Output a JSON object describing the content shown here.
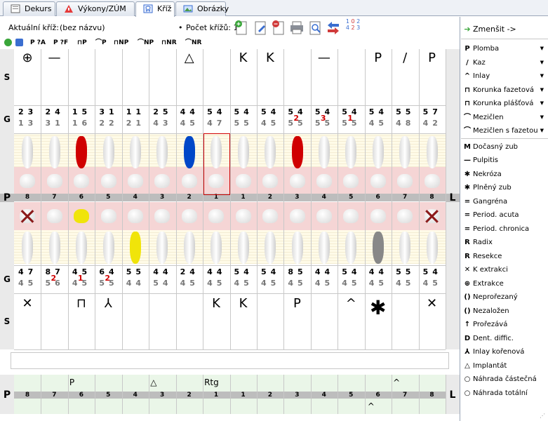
{
  "tabs": [
    {
      "label": "Dekurs",
      "icon": "document-icon"
    },
    {
      "label": "Výkony/ZÚM",
      "icon": "warning-icon"
    },
    {
      "label": "Kříž",
      "icon": "tooth-icon"
    },
    {
      "label": "Obrázky",
      "icon": "images-icon"
    }
  ],
  "toolbar": {
    "current_label": "Aktuální kříž:",
    "current_value": "(bez názvu)",
    "count_label": "Počet křížů: 1",
    "dot": "•",
    "small_nums": "1 2 4 0 3"
  },
  "filters": [
    "P",
    "?A",
    "P",
    "?F",
    "P",
    "NP",
    "NP",
    "NR",
    "NR"
  ],
  "filter_labels": [
    "P ?A",
    "P ?F",
    "⊓P",
    "⌒P",
    "⊓NP",
    "⌒NP",
    "⊓NR",
    "⌒NR"
  ],
  "side_labels": {
    "s_top": "S",
    "g_top": "G",
    "p_left": "P",
    "l_right": "L",
    "g_bot": "G",
    "s_bot": "S",
    "p_bottom": "P",
    "l_bottom": "L"
  },
  "upper_symbols": [
    "⊕",
    "—",
    "",
    "",
    "",
    "",
    "△",
    "",
    "K",
    "K",
    "",
    "—",
    "",
    "P",
    "/",
    "P"
  ],
  "upper_g": [
    [
      "2",
      "3",
      "1",
      "3"
    ],
    [
      "2",
      "4",
      "3",
      "1"
    ],
    [
      "1",
      "5",
      "1",
      "6"
    ],
    [
      "3",
      "1",
      "2",
      "2"
    ],
    [
      "1",
      "1",
      "2",
      "1"
    ],
    [
      "2",
      "5",
      "4",
      "3"
    ],
    [
      "4",
      "4",
      "4",
      "5"
    ],
    [
      "5",
      "4",
      "4",
      "7"
    ],
    [
      "5",
      "4",
      "5",
      "5"
    ],
    [
      "5",
      "4",
      "4",
      "5"
    ],
    [
      "5",
      "4",
      "2",
      "4",
      "5",
      "5"
    ],
    [
      "5",
      "4",
      "3",
      "4",
      "5",
      "5"
    ],
    [
      "5",
      "4",
      "1",
      "4",
      "5",
      "5"
    ],
    [
      "5",
      "4",
      "4",
      "5"
    ],
    [
      "5",
      "5",
      "4",
      "8"
    ],
    [
      "5",
      "7",
      "4",
      "2"
    ]
  ],
  "p_numbers": [
    "8",
    "7",
    "6",
    "5",
    "4",
    "3",
    "2",
    "1",
    "1",
    "2",
    "3",
    "4",
    "5",
    "6",
    "7",
    "8"
  ],
  "lower_g": [
    [
      "4",
      "7",
      "4",
      "5"
    ],
    [
      "8",
      "7",
      "2",
      "5",
      "6"
    ],
    [
      "4",
      "5",
      "1",
      "4",
      "5"
    ],
    [
      "6",
      "4",
      "2",
      "5",
      "5"
    ],
    [
      "5",
      "5",
      "4",
      "4"
    ],
    [
      "4",
      "4",
      "5",
      "4"
    ],
    [
      "2",
      "4",
      "4",
      "5"
    ],
    [
      "4",
      "4",
      "4",
      "5"
    ],
    [
      "5",
      "4",
      "4",
      "5"
    ],
    [
      "5",
      "4",
      "4",
      "5"
    ],
    [
      "8",
      "5",
      "4",
      "5"
    ],
    [
      "4",
      "4",
      "4",
      "5"
    ],
    [
      "5",
      "4",
      "4",
      "5"
    ],
    [
      "4",
      "4",
      "4",
      "5"
    ],
    [
      "5",
      "5",
      "4",
      "5"
    ],
    [
      "5",
      "4",
      "4",
      "5"
    ]
  ],
  "lower_symbols": [
    "✕",
    "",
    "⊓",
    "⅄",
    "",
    "",
    "",
    "K",
    "K",
    "",
    "P",
    "",
    "^",
    "✱",
    "",
    "✕"
  ],
  "bottom_symbols": [
    "",
    "",
    "P",
    "",
    "",
    "△",
    "",
    "Rtg",
    "",
    "",
    "",
    "",
    "",
    "",
    "^",
    ""
  ],
  "right_panel": {
    "header": "Zmenšit ->",
    "items": [
      {
        "icon": "P",
        "label": "Plomba",
        "arrow": true
      },
      {
        "icon": "/",
        "label": "Kaz",
        "arrow": true
      },
      {
        "icon": "^",
        "label": "Inlay",
        "arrow": true
      },
      {
        "icon": "⊓",
        "label": "Korunka fazetová",
        "arrow": true
      },
      {
        "icon": "⊓",
        "label": "Korunka plášťová",
        "arrow": true
      },
      {
        "icon": "⌒",
        "label": "Mezičlen",
        "arrow": true
      },
      {
        "icon": "⌒",
        "label": "Mezičlen s fazetou",
        "arrow": true
      },
      {
        "icon": "M",
        "label": "Dočasný zub",
        "arrow": false
      },
      {
        "icon": "—",
        "label": "Pulpitis",
        "arrow": false
      },
      {
        "icon": "✱",
        "label": "Nekróza",
        "arrow": false
      },
      {
        "icon": "✱",
        "label": "Plněný zub",
        "arrow": false
      },
      {
        "icon": "=",
        "label": "Gangréna",
        "arrow": false
      },
      {
        "icon": "=",
        "label": "Period. acuta",
        "arrow": false
      },
      {
        "icon": "=",
        "label": "Period. chronica",
        "arrow": false
      },
      {
        "icon": "R",
        "label": "Radix",
        "arrow": false
      },
      {
        "icon": "R",
        "label": "Resekce",
        "arrow": false
      },
      {
        "icon": "✕",
        "label": "K extrakci",
        "arrow": false
      },
      {
        "icon": "⊕",
        "label": "Extrakce",
        "arrow": false
      },
      {
        "icon": "()",
        "label": "Neprořezaný",
        "arrow": false
      },
      {
        "icon": "()",
        "label": "Nezaložen",
        "arrow": false
      },
      {
        "icon": "↑",
        "label": "Prořezává",
        "arrow": false
      },
      {
        "icon": "D",
        "label": "Dent. diffic.",
        "arrow": false
      },
      {
        "icon": "⅄",
        "label": "Inlay kořenová",
        "arrow": false
      },
      {
        "icon": "△",
        "label": "Implantát",
        "arrow": false
      },
      {
        "icon": "○",
        "label": "Náhrada částečná",
        "arrow": false
      },
      {
        "icon": "○",
        "label": "Náhrada totální",
        "arrow": false
      }
    ]
  },
  "colors": {
    "red": "#d00000",
    "pink": "#f5d5d5",
    "green": "#eaf6e8",
    "band": "#bdbdbd"
  }
}
